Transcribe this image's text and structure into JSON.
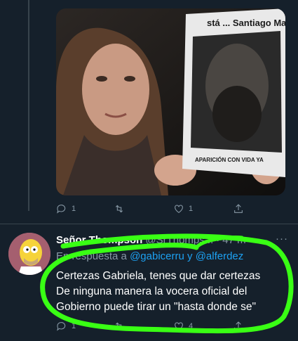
{
  "first_tweet": {
    "image": {
      "sign_header": "stá ... Santiago Maldonado?",
      "sign_footer": "APARICIÓN CON VIDA YA"
    },
    "actions": {
      "reply_count": "1",
      "retweet_count": "",
      "like_count": "1"
    }
  },
  "reply_tweet": {
    "author_name": "Señor Thompson",
    "author_handle": "@SrThomps...",
    "dot": "·",
    "timestamp": "47 m",
    "more_label": "···",
    "reply_prefix": "En respuesta a",
    "mention_1": "@gabicerru",
    "reply_joiner": "y",
    "mention_2": "@alferdez",
    "text_lines": [
      "Certezas Gabriela, tenes que dar certezas",
      "De ninguna manera la vocera oficial del",
      "Gobierno puede tirar un \"hasta donde se\""
    ],
    "actions": {
      "reply_count": "1",
      "retweet_count": "",
      "like_count": "4"
    }
  },
  "colors": {
    "background": "#15202b",
    "secondary_text": "#8899a6",
    "mention": "#1da1f2",
    "scribble": "#39ff14"
  },
  "icons": [
    "reply-icon",
    "retweet-icon",
    "like-icon",
    "share-icon",
    "more-icon"
  ]
}
